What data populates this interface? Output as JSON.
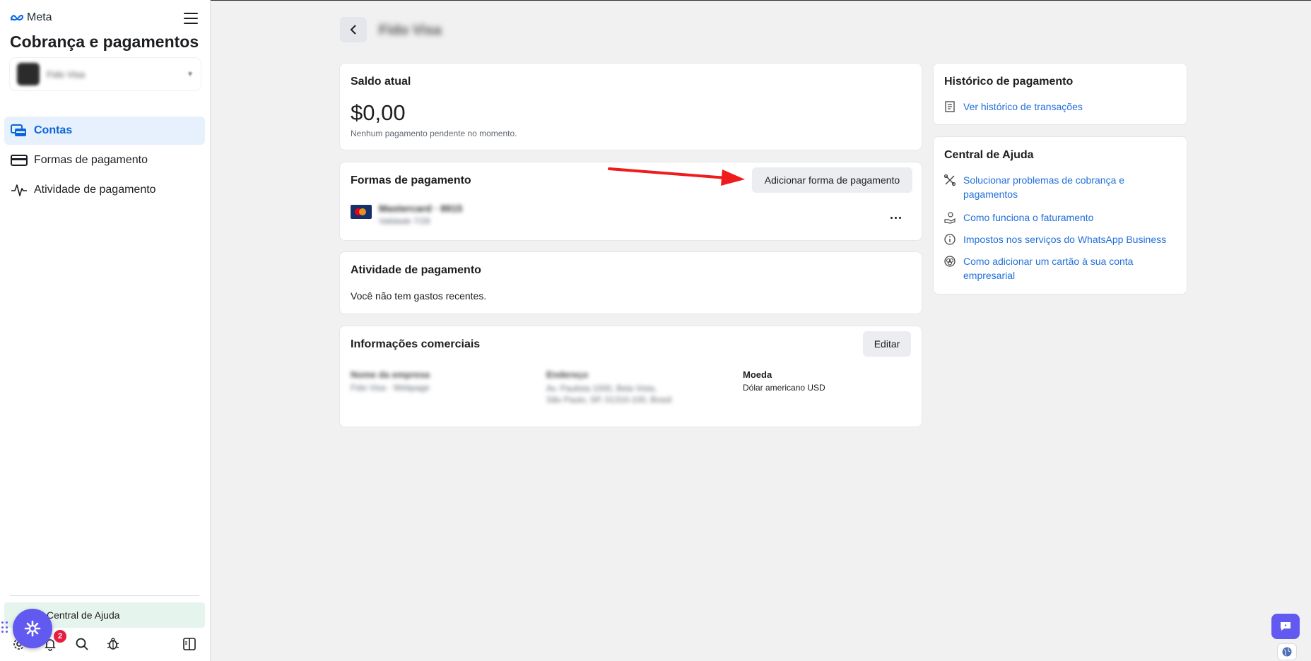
{
  "app": {
    "brand": "Meta",
    "section_title": "Cobrança e pagamentos"
  },
  "account": {
    "name": "Fido Visa"
  },
  "nav": [
    {
      "label": "Contas",
      "active": true
    },
    {
      "label": "Formas de pagamento",
      "active": false
    },
    {
      "label": "Atividade de pagamento",
      "active": false
    }
  ],
  "sidebar_bottom": {
    "help_label": "Central de Ajuda",
    "notification_count": "2"
  },
  "page": {
    "title": "Fido Visa"
  },
  "balance": {
    "title": "Saldo atual",
    "amount": "$0,00",
    "note": "Nenhum pagamento pendente no momento."
  },
  "payment_methods": {
    "title": "Formas de pagamento",
    "add_button": "Adicionar forma de pagamento",
    "card_name": "Mastercard · 8915",
    "card_expiry": "Validade 7/28"
  },
  "activity": {
    "title": "Atividade de pagamento",
    "empty": "Você não tem gastos recentes."
  },
  "business_info": {
    "title": "Informações comerciais",
    "edit_button": "Editar",
    "name_label": "Nome da empresa",
    "name_value": "Fido Visa · Webpage",
    "address_label": "Endereço",
    "address_value": "Av. Paulista 1000, Bela Vista, São Paulo, SP, 01310-100, Brasil",
    "currency_label": "Moeda",
    "currency_value": "Dólar americano USD"
  },
  "history": {
    "title": "Histórico de pagamento",
    "link": "Ver histórico de transações"
  },
  "help_center": {
    "title": "Central de Ajuda",
    "links": [
      "Solucionar problemas de cobrança e pagamentos",
      "Como funciona o faturamento",
      "Impostos nos serviços do WhatsApp Business",
      "Como adicionar um cartão à sua conta empresarial"
    ]
  },
  "colors": {
    "accent": "#216fdb",
    "nav_active_bg": "#e7f0fd",
    "fab": "#6259f0",
    "annotation_arrow": "#ee1c1c"
  }
}
